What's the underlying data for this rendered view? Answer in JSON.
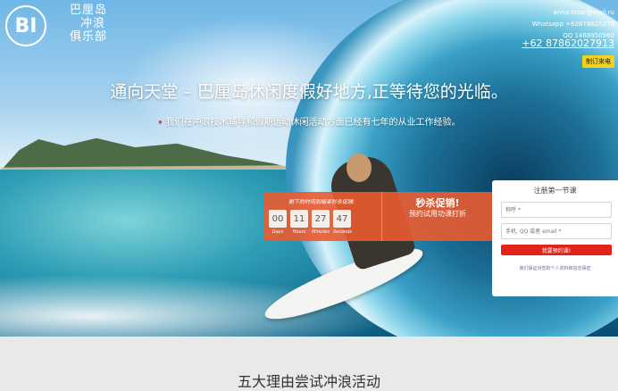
{
  "brand": {
    "logo_text": "BI",
    "lines": [
      "巴厘岛",
      "冲浪",
      "俱乐部"
    ]
  },
  "contact": {
    "email": "anna-lazar@mail.ru",
    "whatsapp": "Whatsapp +62878620279",
    "qq": "QQ 1468950960",
    "phone": "+62 87862027913",
    "callback_label": "制订来电"
  },
  "hero": {
    "headline": "通向天堂 – 巴厘岛休闲度假好地方,正等待您的光临。",
    "subline": "我们在冲浪技术辅导和假期运动休闲活动方面已经有七年的从业工作经验。"
  },
  "promo": {
    "caption": "剩下的时间到结束秒杀促销:",
    "timer": [
      {
        "value": "00",
        "label": "Days"
      },
      {
        "value": "11",
        "label": "Hours"
      },
      {
        "value": "27",
        "label": "Minutes"
      },
      {
        "value": "47",
        "label": "Seconds"
      }
    ],
    "title": "秒杀促销!",
    "subtitle": "预约试用功课打折"
  },
  "form": {
    "title": "注册第一节课",
    "name_placeholder": "称呼 *",
    "contact_placeholder": "手机, QQ 或者 email *",
    "submit_label": "我要预约课!",
    "privacy": "我们保证对您的个人资料和信息保密"
  },
  "section": {
    "title": "五大理由尝试冲浪活动"
  }
}
